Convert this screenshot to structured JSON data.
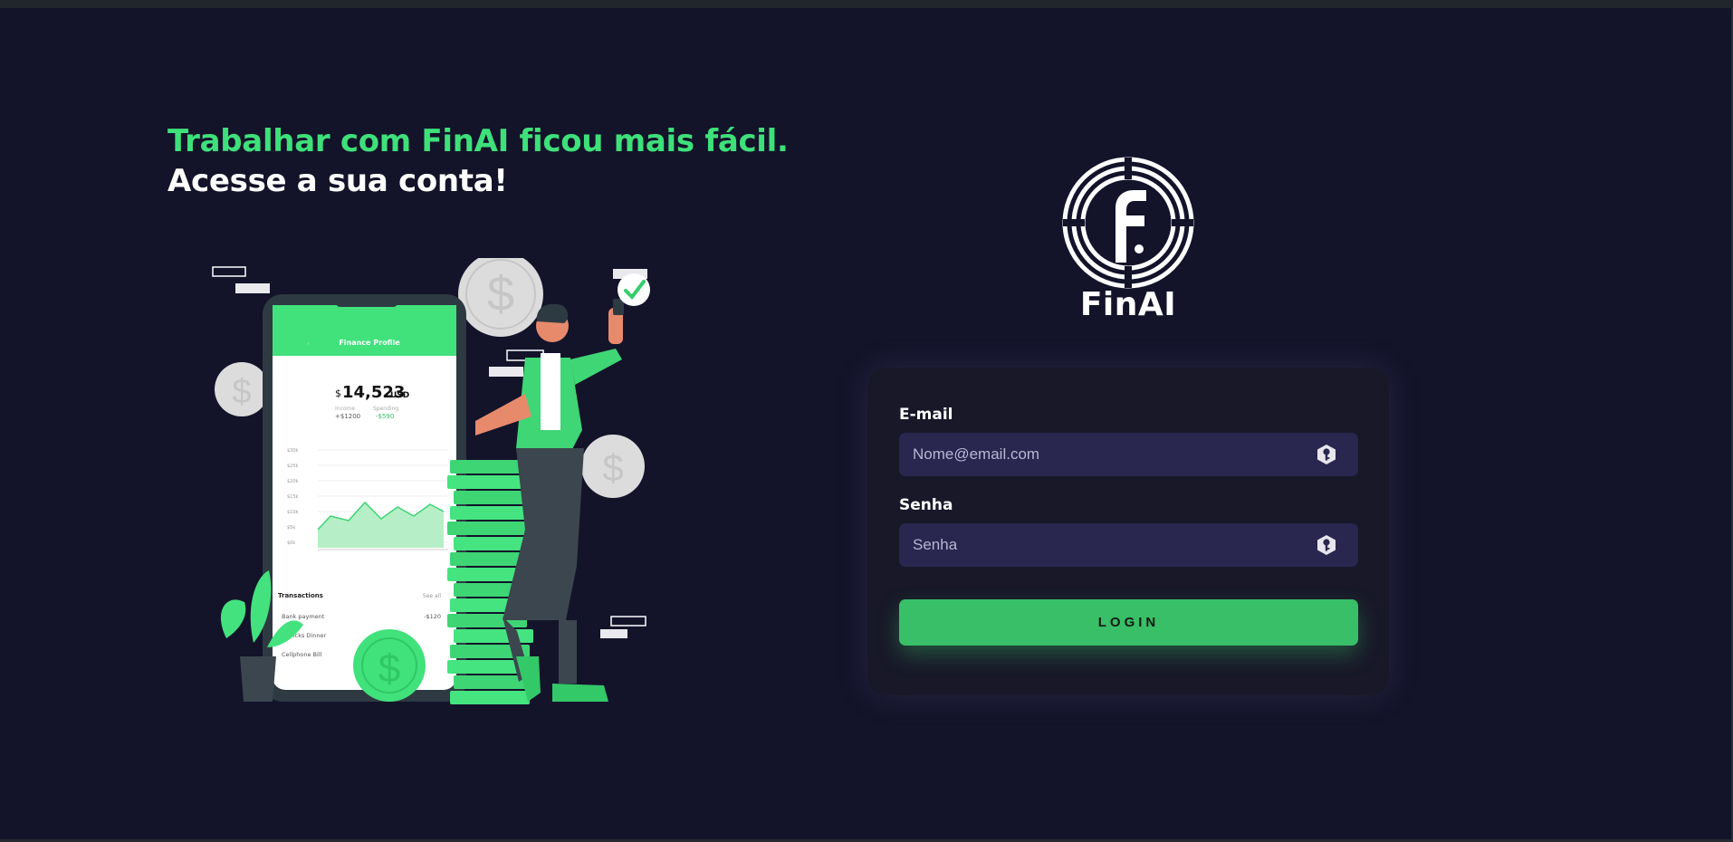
{
  "hero": {
    "headline_line1": "Trabalhar com FinAI ficou mais fácil.",
    "headline_line2": "Acesse a sua conta!"
  },
  "illustration": {
    "app_header": "Finance Profile",
    "balance_currency": "$",
    "balance_amount": "14,523",
    "balance_unit": "USD",
    "income_label": "Income",
    "income_value": "+$1200",
    "spending_label": "Spending",
    "spending_value": "-$590",
    "y_ticks": [
      "$30k",
      "$25k",
      "$20k",
      "$15k",
      "$10k",
      "$5k",
      "$0k"
    ],
    "transactions_title": "Transactions",
    "see_all": "See all",
    "transactions": [
      {
        "name": "Bank payment",
        "amount": "-$120"
      },
      {
        "name": "Patricks Dinner",
        "amount": ""
      },
      {
        "name": "Cellphone Bill",
        "amount": ""
      }
    ]
  },
  "brand": {
    "name": "FinAI"
  },
  "login_form": {
    "email_label": "E-mail",
    "email_placeholder": "Nome@email.com",
    "password_label": "Senha",
    "password_placeholder": "Senha",
    "login_button": "LOGIN"
  },
  "colors": {
    "background": "#13132a",
    "accent": "#3ee07a",
    "button": "#39bf67",
    "input": "#29264f",
    "card": "#181828"
  },
  "icons": {
    "logo": "finai-logo-icon",
    "input_icon": "key-icon"
  }
}
